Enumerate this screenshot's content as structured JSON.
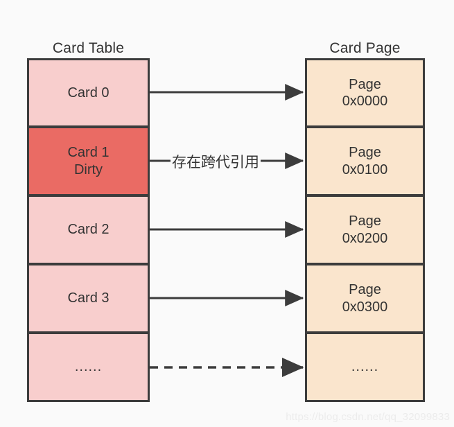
{
  "diagram": {
    "title_left": "Card Table",
    "title_right": "Card Page",
    "edge_label": "存在跨代引用",
    "watermark": "https://blog.csdn.net/qq_32099833",
    "colors": {
      "background": "#fafafa",
      "card_clean_fill": "#f8cecd",
      "card_dirty_fill": "#ea6b64",
      "page_fill": "#fae5cd",
      "stroke": "#3c3c3c",
      "text": "#333333",
      "watermark": "#ececec"
    },
    "card_table": {
      "heading": "Card Table",
      "cells": [
        {
          "id": "card-0",
          "line1": "Card 0",
          "line2": "",
          "state": "clean"
        },
        {
          "id": "card-1",
          "line1": "Card 1",
          "line2": "Dirty",
          "state": "dirty"
        },
        {
          "id": "card-2",
          "line1": "Card 2",
          "line2": "",
          "state": "clean"
        },
        {
          "id": "card-3",
          "line1": "Card 3",
          "line2": "",
          "state": "clean"
        },
        {
          "id": "card-more",
          "line1": "......",
          "line2": "",
          "state": "clean"
        }
      ]
    },
    "card_page": {
      "heading": "Card Page",
      "cells": [
        {
          "id": "page-0000",
          "line1": "Page",
          "line2": "0x0000"
        },
        {
          "id": "page-0100",
          "line1": "Page",
          "line2": "0x0100"
        },
        {
          "id": "page-0200",
          "line1": "Page",
          "line2": "0x0200"
        },
        {
          "id": "page-0300",
          "line1": "Page",
          "line2": "0x0300"
        },
        {
          "id": "page-more",
          "line1": "......",
          "line2": ""
        }
      ]
    },
    "connectors": [
      {
        "from": "card-0",
        "to": "page-0000",
        "style": "solid",
        "label": ""
      },
      {
        "from": "card-1",
        "to": "page-0100",
        "style": "solid",
        "label": "存在跨代引用"
      },
      {
        "from": "card-2",
        "to": "page-0200",
        "style": "solid",
        "label": ""
      },
      {
        "from": "card-3",
        "to": "page-0300",
        "style": "solid",
        "label": ""
      },
      {
        "from": "card-more",
        "to": "page-more",
        "style": "dashed",
        "label": ""
      }
    ]
  }
}
